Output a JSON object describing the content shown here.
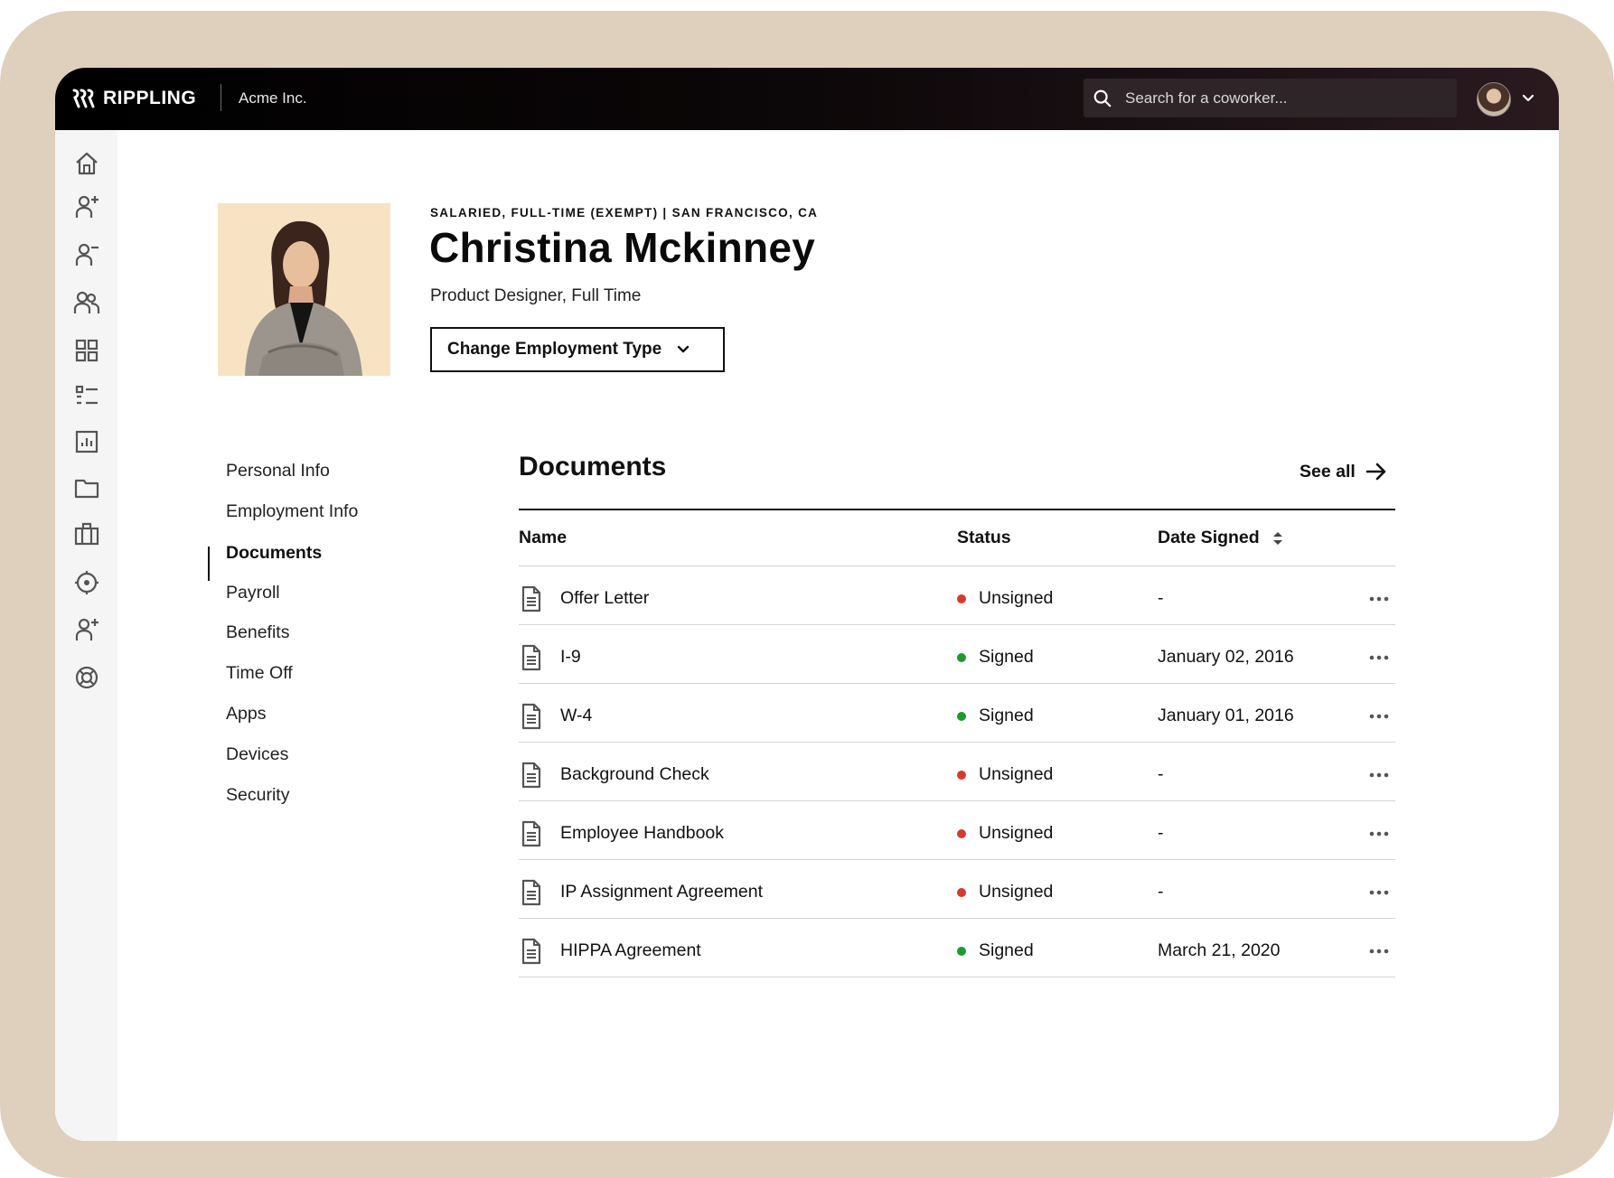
{
  "app": {
    "brand": "RIPPLING",
    "company": "Acme Inc."
  },
  "search": {
    "placeholder": "Search for a coworker..."
  },
  "sidebar": {
    "icons": [
      "home-icon",
      "add-person-icon",
      "remove-person-icon",
      "people-icon",
      "apps-grid-icon",
      "list-icon",
      "reports-icon",
      "folder-icon",
      "briefcase-icon",
      "settings-icon",
      "invite-person-icon",
      "support-icon"
    ]
  },
  "profile": {
    "meta": "SALARIED, FULL-TIME (EXEMPT) | SAN FRANCISCO, CA",
    "name": "Christina Mckinney",
    "role": "Product Designer, Full Time",
    "change_button": "Change Employment Type"
  },
  "nav": {
    "items": [
      {
        "label": "Personal Info"
      },
      {
        "label": "Employment Info"
      },
      {
        "label": "Documents",
        "active": true
      },
      {
        "label": "Payroll"
      },
      {
        "label": "Benefits"
      },
      {
        "label": "Time Off"
      },
      {
        "label": "Apps"
      },
      {
        "label": "Devices"
      },
      {
        "label": "Security"
      }
    ]
  },
  "documents": {
    "title": "Documents",
    "see_all": "See all",
    "columns": {
      "name": "Name",
      "status": "Status",
      "date": "Date Signed"
    },
    "status_colors": {
      "Signed": "#1f9a2e",
      "Unsigned": "#d63a2f"
    },
    "rows": [
      {
        "name": "Offer Letter",
        "status": "Unsigned",
        "date": "-"
      },
      {
        "name": "I-9",
        "status": "Signed",
        "date": "January 02, 2016"
      },
      {
        "name": "W-4",
        "status": "Signed",
        "date": "January 01, 2016"
      },
      {
        "name": "Background Check",
        "status": "Unsigned",
        "date": "-"
      },
      {
        "name": "Employee Handbook",
        "status": "Unsigned",
        "date": "-"
      },
      {
        "name": "IP Assignment Agreement",
        "status": "Unsigned",
        "date": "-"
      },
      {
        "name": "HIPPA Agreement",
        "status": "Signed",
        "date": "March 21, 2020"
      }
    ]
  }
}
